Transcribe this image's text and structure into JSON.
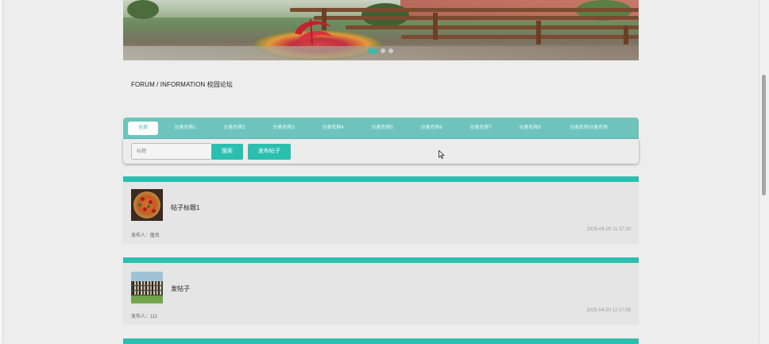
{
  "breadcrumb": "FORUM / INFORMATION 校园论坛",
  "carousel": {
    "slide_count": 3,
    "active_index": 0
  },
  "categories": [
    {
      "label": "全部",
      "active": true
    },
    {
      "label": "分类名称1"
    },
    {
      "label": "分类名称2"
    },
    {
      "label": "分类名称3"
    },
    {
      "label": "分类名称4"
    },
    {
      "label": "分类名称5"
    },
    {
      "label": "分类名称6"
    },
    {
      "label": "分类名称7"
    },
    {
      "label": "分类名称8"
    },
    {
      "label": "分类名称分类名称"
    }
  ],
  "search": {
    "placeholder": "标题",
    "value": "",
    "search_label": "搜索",
    "publish_label": "发布帖子"
  },
  "posts": [
    {
      "title": "帖子标题1",
      "author_label": "发布人：匿名",
      "time": "2025-04-20 11:37:10",
      "thumb": "pizza-image"
    },
    {
      "title": "发帖子",
      "author_label": "发布人：111",
      "time": "2025-04-20 12:17:08",
      "thumb": "group-photo-image"
    }
  ],
  "colors": {
    "accent": "#2bbfb0",
    "tab_bar": "#6ec4bc",
    "page_bg": "#ededed",
    "card_bg": "#e4e5e4"
  }
}
